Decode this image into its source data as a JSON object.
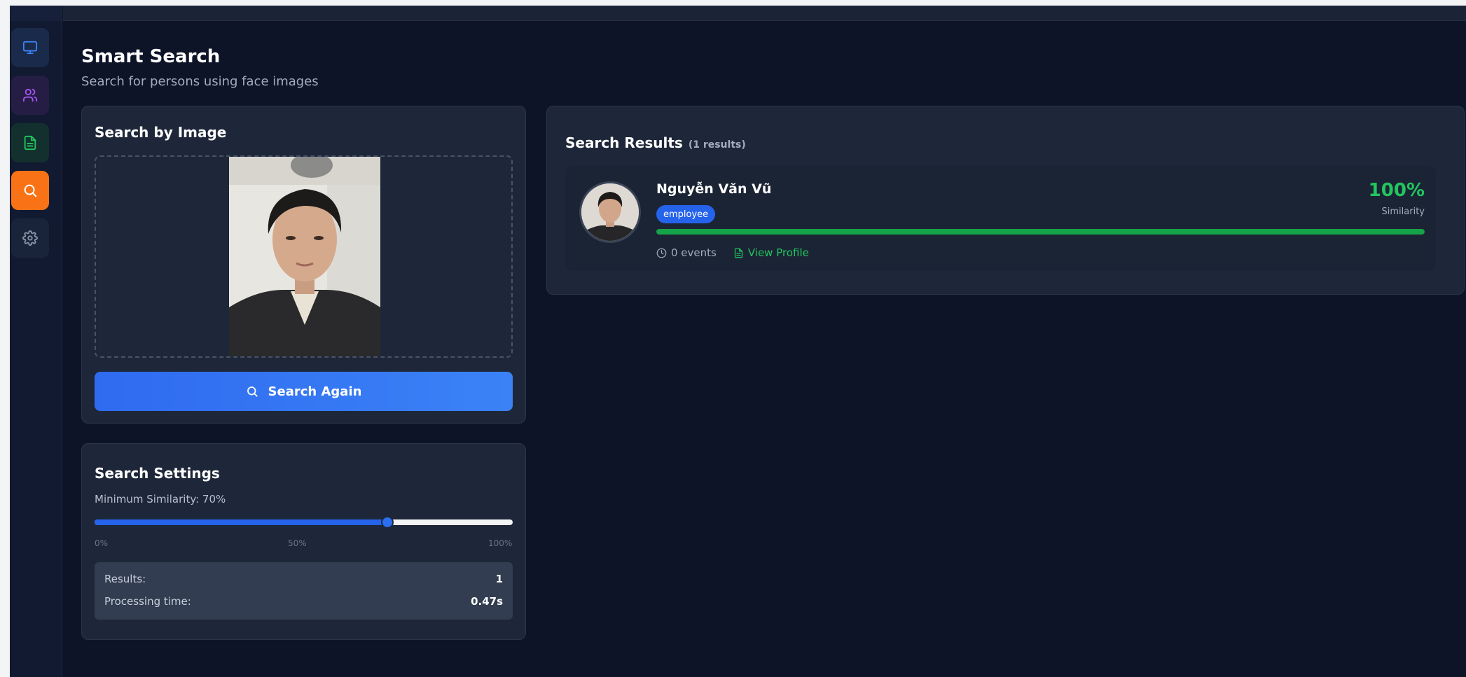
{
  "page": {
    "title": "Smart Search",
    "subtitle": "Search for persons using face images"
  },
  "sidebar": {
    "items": [
      {
        "name": "monitor",
        "icon": "monitor-icon",
        "color": "#3b82f6",
        "bg": "#1a2a4a"
      },
      {
        "name": "users",
        "icon": "users-icon",
        "color": "#a855f7",
        "bg": "#261d44"
      },
      {
        "name": "reports",
        "icon": "file-text-icon",
        "color": "#22c55e",
        "bg": "#13302f"
      },
      {
        "name": "search",
        "icon": "search-icon",
        "color": "#ffffff",
        "bg": "#f97316",
        "active": true
      },
      {
        "name": "settings",
        "icon": "gear-icon",
        "color": "#8b95a8",
        "bg": "#19233a"
      }
    ]
  },
  "search_by_image": {
    "title": "Search by Image",
    "button_label": "Search Again"
  },
  "settings": {
    "title": "Search Settings",
    "min_similarity_label": "Minimum Similarity: 70%",
    "min_similarity_value": 70,
    "ticks": [
      "0%",
      "50%",
      "100%"
    ],
    "stats": [
      {
        "label": "Results:",
        "value": "1"
      },
      {
        "label": "Processing time:",
        "value": "0.47s"
      }
    ]
  },
  "results": {
    "title": "Search Results",
    "count_label": "(1 results)",
    "items": [
      {
        "name": "Nguyễn Văn Vũ",
        "role": "employee",
        "similarity": "100%",
        "similarity_value": 100,
        "similarity_label": "Similarity",
        "events": "0 events",
        "view_profile": "View Profile"
      }
    ]
  }
}
